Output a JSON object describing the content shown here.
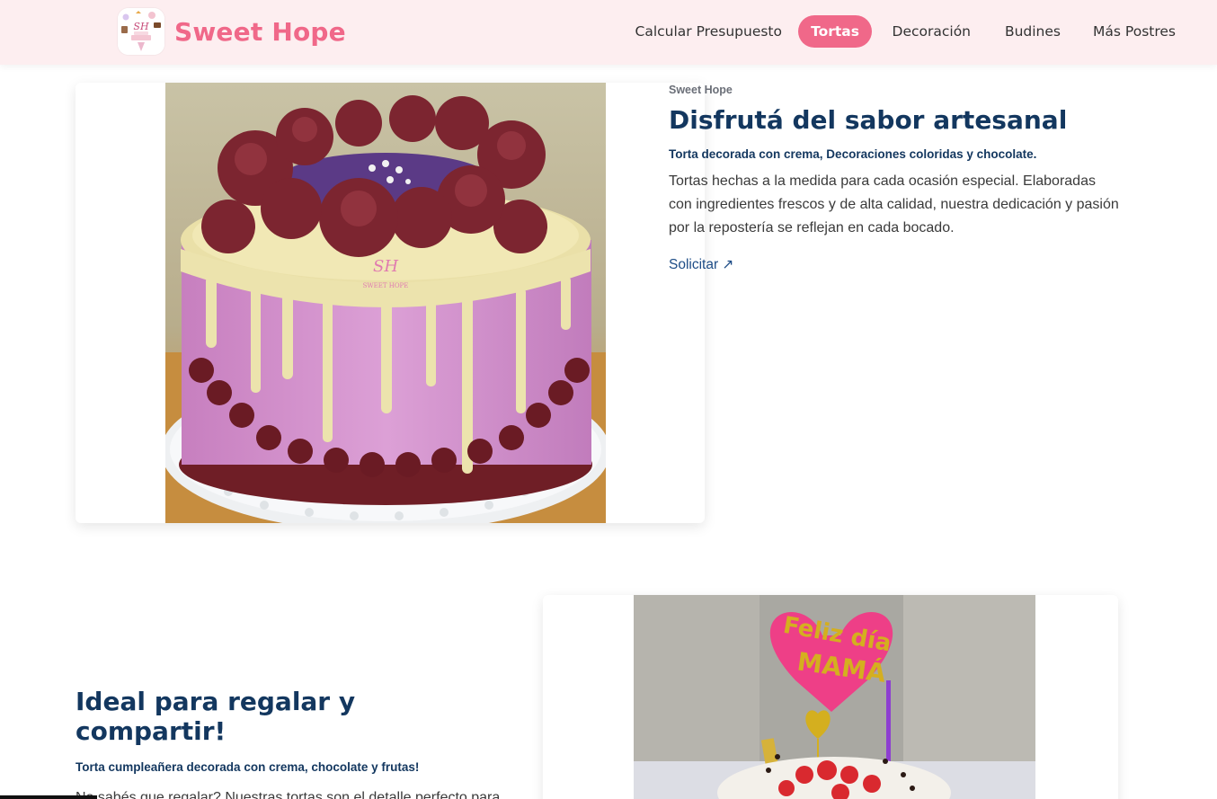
{
  "header": {
    "brand_name": "Sweet Hope",
    "brand_color": "#f06889",
    "logo_icon": "cake-logo-icon",
    "logo_initials": "SH",
    "nav": [
      {
        "label": "Calcular Presupuesto",
        "active": false
      },
      {
        "label": "Tortas",
        "active": true
      },
      {
        "label": "Decoración",
        "active": false
      },
      {
        "label": "Budines",
        "active": false
      },
      {
        "label": "Más Postres",
        "active": false
      }
    ]
  },
  "section1": {
    "eyebrow": "Sweet Hope",
    "title": "Disfrutá del sabor artesanal",
    "subtitle": "Torta decorada con crema, Decoraciones coloridas y chocolate.",
    "body": "Tortas hechas a la medida para cada ocasión especial. Elaboradas con ingredientes frescos y de alta calidad, nuestra dedicación y pasión por la repostería se reflejan en cada bocado.",
    "cta": "Solicitar ↗",
    "image_watermark_initials": "SH",
    "image_watermark_text": "SWEET HOPE"
  },
  "section2": {
    "title": "Ideal para regalar y compartir!",
    "subtitle": "Torta cumpleañera decorada con crema, chocolate y frutas!",
    "body": "No sabés que regalar? Nuestras tortas son el detalle perfecto para sorprender a tus seres queridos en cumpleaños, aniversarios,",
    "topper_line1": "Feliz día",
    "topper_line2": "MAMÁ"
  },
  "colors": {
    "header_bg": "#fdeef0",
    "accent": "#f06889",
    "heading": "#13375f",
    "link": "#1d4c86"
  }
}
